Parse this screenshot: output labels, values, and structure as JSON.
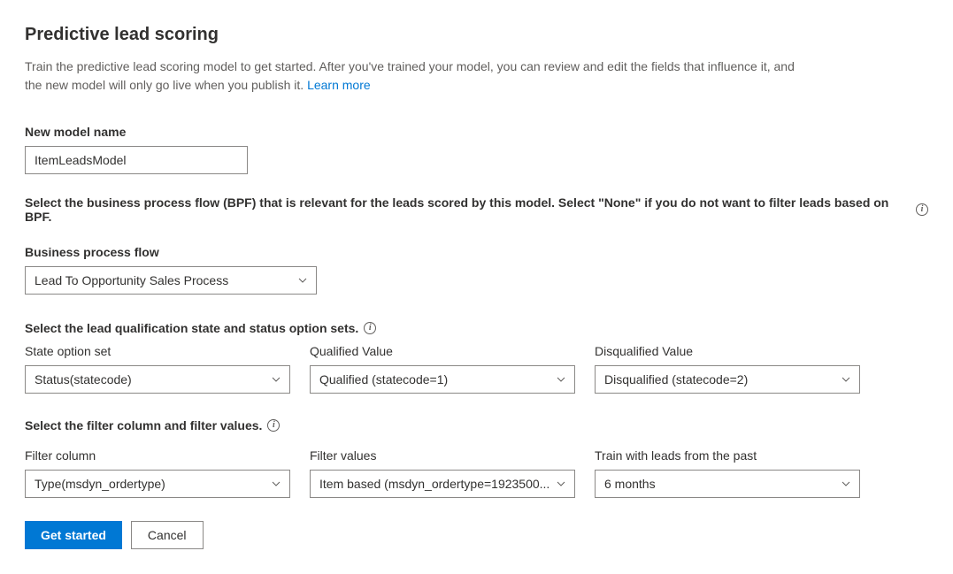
{
  "page": {
    "title": "Predictive lead scoring",
    "intro": "Train the predictive lead scoring model to get started. After you've trained your model, you can review and edit the fields that influence it, and the new model will only go live when you publish it. ",
    "learn_more": "Learn more"
  },
  "model_name": {
    "label": "New model name",
    "value": "ItemLeadsModel"
  },
  "bpf": {
    "section_label": "Select the business process flow (BPF) that is relevant for the leads scored by this model. Select \"None\" if you do not want to filter leads based on BPF.",
    "label": "Business process flow",
    "value": "Lead To Opportunity Sales Process"
  },
  "qualification": {
    "section_label": "Select the lead qualification state and status option sets.",
    "state_option_set": {
      "label": "State option set",
      "value": "Status(statecode)"
    },
    "qualified_value": {
      "label": "Qualified Value",
      "value": "Qualified (statecode=1)"
    },
    "disqualified_value": {
      "label": "Disqualified Value",
      "value": "Disqualified (statecode=2)"
    }
  },
  "filter": {
    "section_label": "Select the filter column and filter values.",
    "filter_column": {
      "label": "Filter column",
      "value": "Type(msdyn_ordertype)"
    },
    "filter_values": {
      "label": "Filter values",
      "value": "Item based (msdyn_ordertype=1923500..."
    },
    "train_past": {
      "label": "Train with leads from the past",
      "value": "6 months"
    }
  },
  "buttons": {
    "get_started": "Get started",
    "cancel": "Cancel"
  }
}
